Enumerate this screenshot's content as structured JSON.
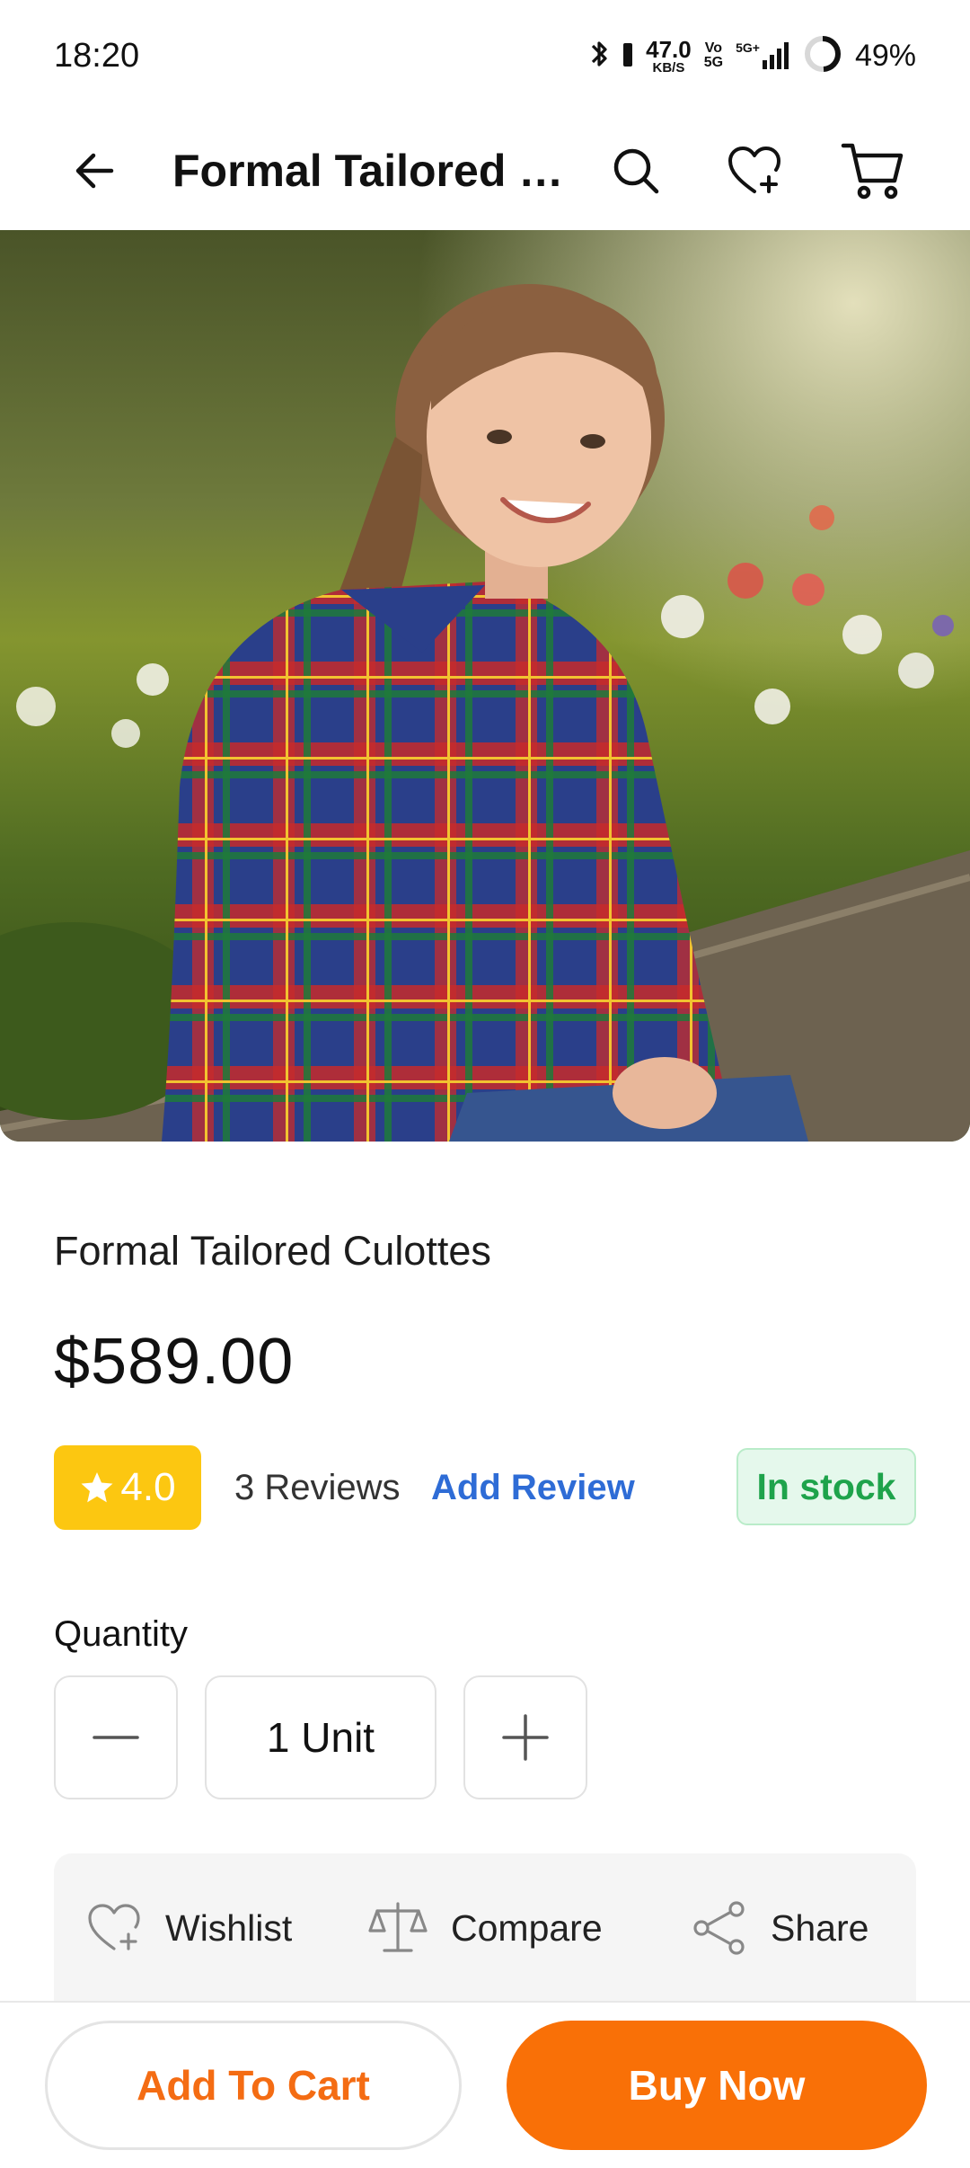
{
  "status_bar": {
    "time": "18:20",
    "net_speed_value": "47.0",
    "net_speed_unit": "KB/S",
    "volte_top": "Vo",
    "volte_bottom": "5G",
    "signal_label": "5G+",
    "battery_percent": "49%",
    "battery_level": 0.49
  },
  "header": {
    "title": "Formal Tailored Culottes",
    "icons": [
      "back-arrow-icon",
      "search-icon",
      "heart-plus-icon",
      "cart-icon"
    ]
  },
  "product": {
    "name": "Formal Tailored Culottes",
    "price": "$589.00",
    "rating": "4.0",
    "reviews": "3 Reviews",
    "add_review": "Add Review",
    "stock": "In stock"
  },
  "quantity": {
    "label": "Quantity",
    "value": "1 Unit"
  },
  "actions": {
    "wishlist": "Wishlist",
    "compare": "Compare",
    "share": "Share"
  },
  "bottom_bar": {
    "add_to_cart": "Add To Cart",
    "buy_now": "Buy Now"
  },
  "colors": {
    "accent": "#f97007",
    "rating": "#fcc711",
    "link": "#2e6cd6",
    "stock_text": "#1ea34b",
    "stock_bg": "#e5f8ec"
  }
}
